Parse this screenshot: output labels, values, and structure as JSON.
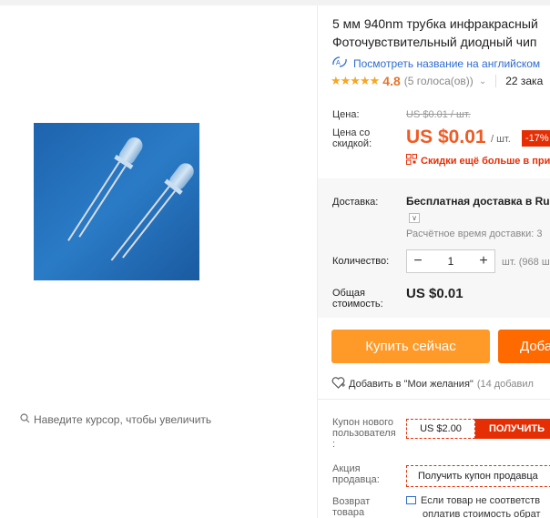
{
  "product": {
    "title_line1": "5 мм 940nm трубка инфракрасный",
    "title_line2": "Фоточувствительный диодный чип",
    "translate_link": "Посмотреть название на английском",
    "rating": "4.8",
    "votes": "(5 голоса(ов))",
    "orders": "22 зака",
    "zoom_hint": "Наведите курсор, чтобы увеличить"
  },
  "price": {
    "price_label": "Цена:",
    "old_price": "US $0.01 / шт.",
    "discount_label_line1": "Цена со",
    "discount_label_line2": "скидкой:",
    "new_price": "US $0.01",
    "per_unit": "/ шт.",
    "discount_badge": "-17%",
    "promo_text": "Скидки ещё больше в при"
  },
  "shipping": {
    "label": "Доставка:",
    "value": "Бесплатная доставка в Rus",
    "time": "Расчётное время доставки: 3"
  },
  "quantity": {
    "label": "Количество:",
    "value": "1",
    "minus": "−",
    "plus": "+",
    "stock": "шт. (968 ш"
  },
  "total": {
    "label_line1": "Общая",
    "label_line2": "стоимость:",
    "value": "US $0.01"
  },
  "actions": {
    "buy_now": "Купить сейчас",
    "add_to_cart": "Доба",
    "wishlist": "Добавить в \"Мои желания\"",
    "wishlist_count": "(14 добавил"
  },
  "coupon": {
    "label_line1": "Купон нового",
    "label_line2": "пользователя",
    "label_line3": ":",
    "amount": "US $2.00",
    "get": "ПОЛУЧИТЬ"
  },
  "seller": {
    "label_line1": "Акция",
    "label_line2": "продавца:",
    "text": "Получить купон продавца"
  },
  "returns": {
    "label_line1": "Возврат",
    "label_line2": "товара",
    "text_line1": "Если товар не соответств",
    "text_line2": "оплатив стоимость обрат"
  },
  "colors": {
    "accent_orange": "#ff9a29",
    "cart_orange": "#ff6a00",
    "price_red": "#f15a22",
    "badge_red": "#e62e04",
    "link_blue": "#2e6ccf",
    "star": "#f5a623"
  }
}
